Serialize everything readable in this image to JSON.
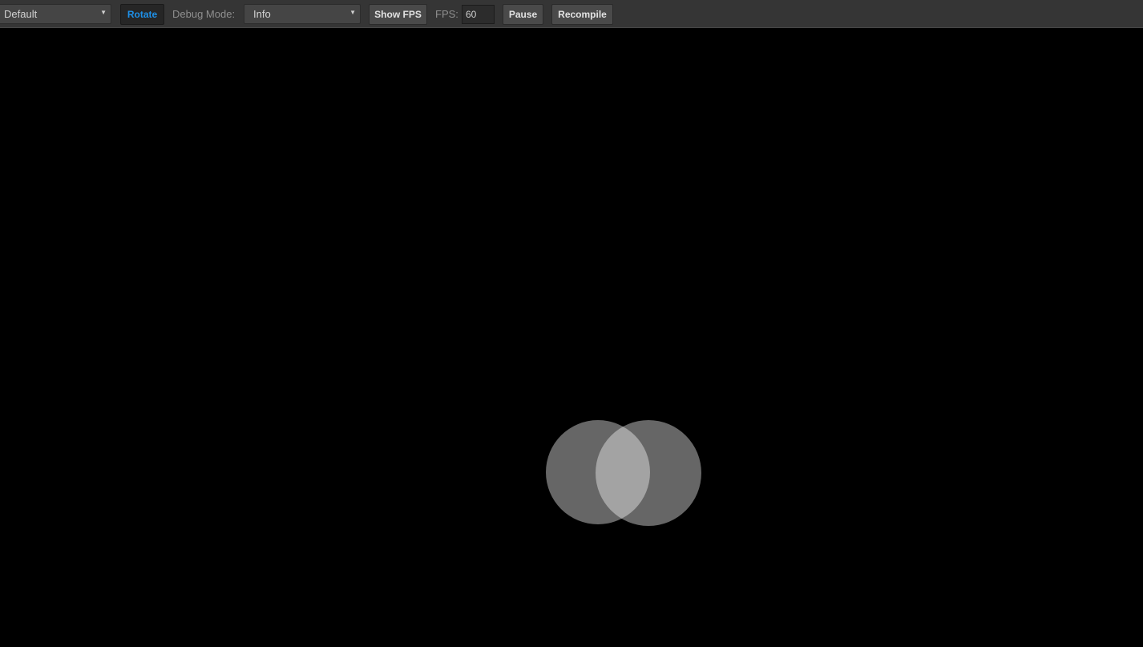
{
  "toolbar": {
    "preset_select": {
      "value": "Default"
    },
    "rotate_label": "Rotate",
    "debug_mode_label": "Debug Mode:",
    "debug_mode_select": {
      "value": "Info"
    },
    "show_fps_label": "Show FPS",
    "fps_label": "FPS:",
    "fps_value": "60",
    "pause_label": "Pause",
    "recompile_label": "Recompile",
    "accent_color": "#1e90e8"
  },
  "viewport": {
    "background": "#000000",
    "circle_fill": "#666666",
    "overlap_fill": "#a3a3a3"
  }
}
